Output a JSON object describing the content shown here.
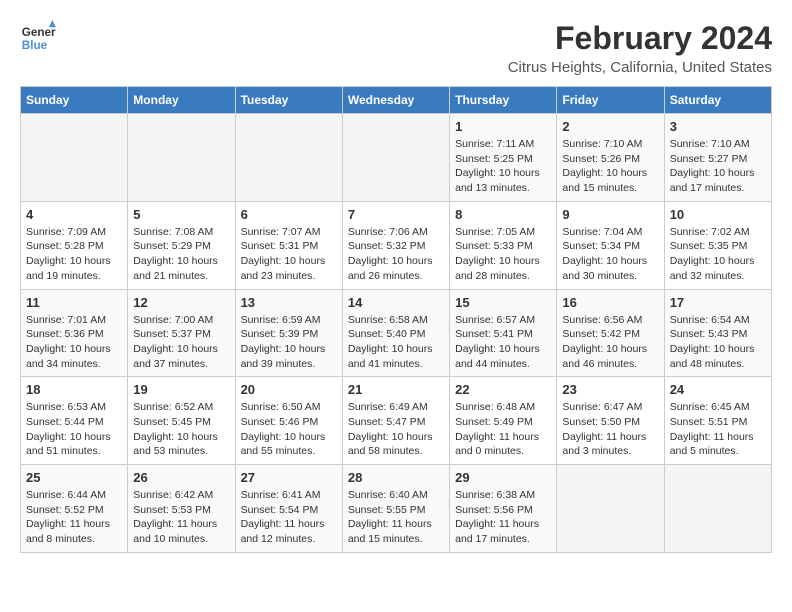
{
  "header": {
    "logo_line1": "General",
    "logo_line2": "Blue",
    "title": "February 2024",
    "subtitle": "Citrus Heights, California, United States"
  },
  "days_of_week": [
    "Sunday",
    "Monday",
    "Tuesday",
    "Wednesday",
    "Thursday",
    "Friday",
    "Saturday"
  ],
  "weeks": [
    [
      {
        "day": "",
        "info": ""
      },
      {
        "day": "",
        "info": ""
      },
      {
        "day": "",
        "info": ""
      },
      {
        "day": "",
        "info": ""
      },
      {
        "day": "1",
        "info": "Sunrise: 7:11 AM\nSunset: 5:25 PM\nDaylight: 10 hours\nand 13 minutes."
      },
      {
        "day": "2",
        "info": "Sunrise: 7:10 AM\nSunset: 5:26 PM\nDaylight: 10 hours\nand 15 minutes."
      },
      {
        "day": "3",
        "info": "Sunrise: 7:10 AM\nSunset: 5:27 PM\nDaylight: 10 hours\nand 17 minutes."
      }
    ],
    [
      {
        "day": "4",
        "info": "Sunrise: 7:09 AM\nSunset: 5:28 PM\nDaylight: 10 hours\nand 19 minutes."
      },
      {
        "day": "5",
        "info": "Sunrise: 7:08 AM\nSunset: 5:29 PM\nDaylight: 10 hours\nand 21 minutes."
      },
      {
        "day": "6",
        "info": "Sunrise: 7:07 AM\nSunset: 5:31 PM\nDaylight: 10 hours\nand 23 minutes."
      },
      {
        "day": "7",
        "info": "Sunrise: 7:06 AM\nSunset: 5:32 PM\nDaylight: 10 hours\nand 26 minutes."
      },
      {
        "day": "8",
        "info": "Sunrise: 7:05 AM\nSunset: 5:33 PM\nDaylight: 10 hours\nand 28 minutes."
      },
      {
        "day": "9",
        "info": "Sunrise: 7:04 AM\nSunset: 5:34 PM\nDaylight: 10 hours\nand 30 minutes."
      },
      {
        "day": "10",
        "info": "Sunrise: 7:02 AM\nSunset: 5:35 PM\nDaylight: 10 hours\nand 32 minutes."
      }
    ],
    [
      {
        "day": "11",
        "info": "Sunrise: 7:01 AM\nSunset: 5:36 PM\nDaylight: 10 hours\nand 34 minutes."
      },
      {
        "day": "12",
        "info": "Sunrise: 7:00 AM\nSunset: 5:37 PM\nDaylight: 10 hours\nand 37 minutes."
      },
      {
        "day": "13",
        "info": "Sunrise: 6:59 AM\nSunset: 5:39 PM\nDaylight: 10 hours\nand 39 minutes."
      },
      {
        "day": "14",
        "info": "Sunrise: 6:58 AM\nSunset: 5:40 PM\nDaylight: 10 hours\nand 41 minutes."
      },
      {
        "day": "15",
        "info": "Sunrise: 6:57 AM\nSunset: 5:41 PM\nDaylight: 10 hours\nand 44 minutes."
      },
      {
        "day": "16",
        "info": "Sunrise: 6:56 AM\nSunset: 5:42 PM\nDaylight: 10 hours\nand 46 minutes."
      },
      {
        "day": "17",
        "info": "Sunrise: 6:54 AM\nSunset: 5:43 PM\nDaylight: 10 hours\nand 48 minutes."
      }
    ],
    [
      {
        "day": "18",
        "info": "Sunrise: 6:53 AM\nSunset: 5:44 PM\nDaylight: 10 hours\nand 51 minutes."
      },
      {
        "day": "19",
        "info": "Sunrise: 6:52 AM\nSunset: 5:45 PM\nDaylight: 10 hours\nand 53 minutes."
      },
      {
        "day": "20",
        "info": "Sunrise: 6:50 AM\nSunset: 5:46 PM\nDaylight: 10 hours\nand 55 minutes."
      },
      {
        "day": "21",
        "info": "Sunrise: 6:49 AM\nSunset: 5:47 PM\nDaylight: 10 hours\nand 58 minutes."
      },
      {
        "day": "22",
        "info": "Sunrise: 6:48 AM\nSunset: 5:49 PM\nDaylight: 11 hours\nand 0 minutes."
      },
      {
        "day": "23",
        "info": "Sunrise: 6:47 AM\nSunset: 5:50 PM\nDaylight: 11 hours\nand 3 minutes."
      },
      {
        "day": "24",
        "info": "Sunrise: 6:45 AM\nSunset: 5:51 PM\nDaylight: 11 hours\nand 5 minutes."
      }
    ],
    [
      {
        "day": "25",
        "info": "Sunrise: 6:44 AM\nSunset: 5:52 PM\nDaylight: 11 hours\nand 8 minutes."
      },
      {
        "day": "26",
        "info": "Sunrise: 6:42 AM\nSunset: 5:53 PM\nDaylight: 11 hours\nand 10 minutes."
      },
      {
        "day": "27",
        "info": "Sunrise: 6:41 AM\nSunset: 5:54 PM\nDaylight: 11 hours\nand 12 minutes."
      },
      {
        "day": "28",
        "info": "Sunrise: 6:40 AM\nSunset: 5:55 PM\nDaylight: 11 hours\nand 15 minutes."
      },
      {
        "day": "29",
        "info": "Sunrise: 6:38 AM\nSunset: 5:56 PM\nDaylight: 11 hours\nand 17 minutes."
      },
      {
        "day": "",
        "info": ""
      },
      {
        "day": "",
        "info": ""
      }
    ]
  ]
}
